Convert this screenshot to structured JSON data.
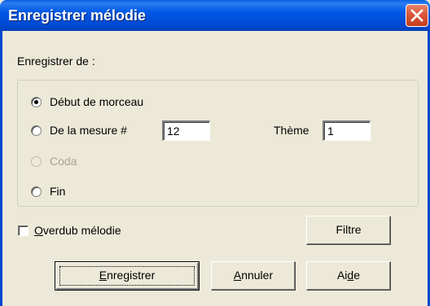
{
  "window": {
    "title": "Enregistrer mélodie"
  },
  "section": {
    "label": "Enregistrer de :"
  },
  "options": {
    "debut": {
      "label": "Début de morceau",
      "checked": true
    },
    "mesure": {
      "label": "De la mesure #",
      "value": "12",
      "checked": false
    },
    "theme": {
      "label": "Thème",
      "value": "1"
    },
    "coda": {
      "label": "Coda",
      "disabled": true
    },
    "fin": {
      "label": "Fin",
      "checked": false
    }
  },
  "overdub": {
    "label_mnemonic": "O",
    "label_rest": "verdub mélodie",
    "checked": false
  },
  "buttons": {
    "filtre": "Filtre",
    "enregistrer": {
      "mnemonic": "E",
      "rest": "nregistrer"
    },
    "annuler": {
      "mnemonic": "A",
      "rest": "nnuler"
    },
    "aide": {
      "pre": "Ai",
      "mnemonic": "d",
      "rest": "e"
    }
  },
  "colors": {
    "titlebar": "#0048d0",
    "dialog_bg": "#ece9d8",
    "close_button": "#d9573a",
    "disabled_text": "#a7a495"
  },
  "icons": {
    "close": "close-icon"
  }
}
